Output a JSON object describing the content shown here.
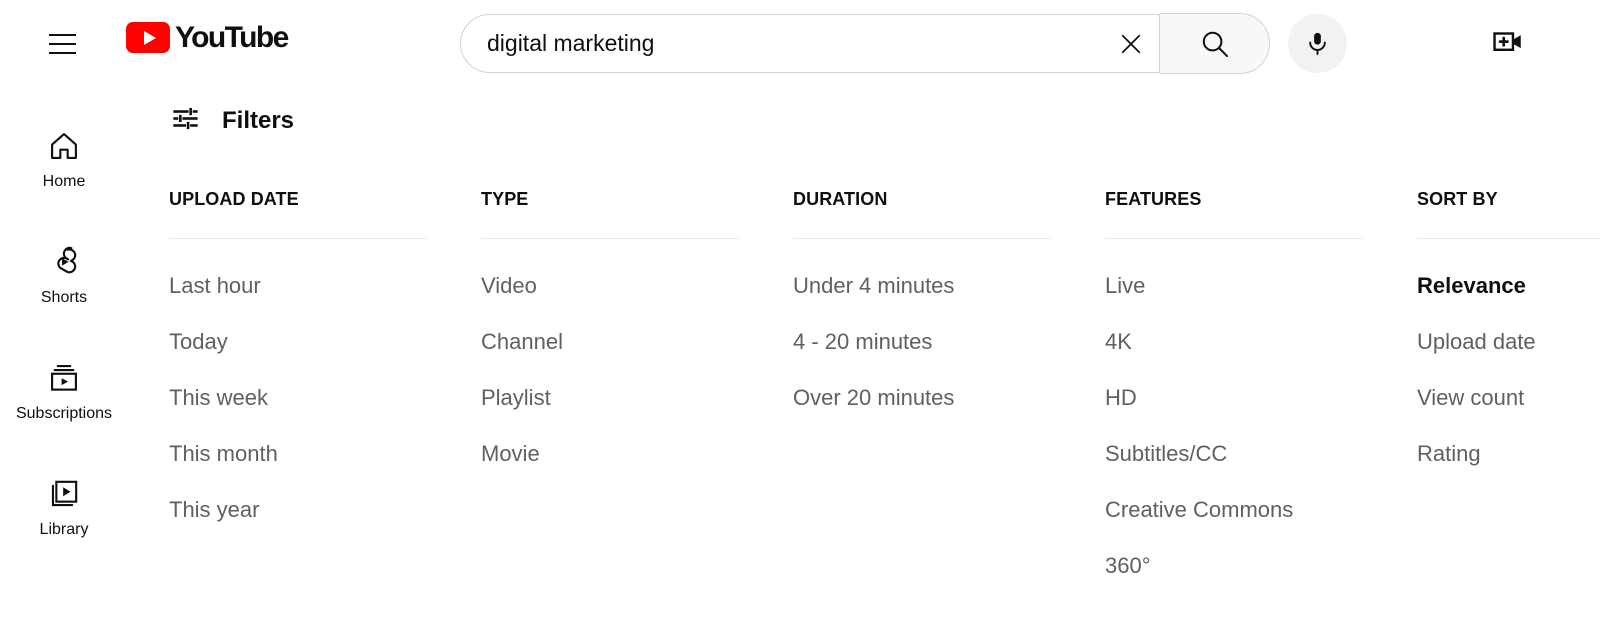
{
  "topbar": {
    "menu_icon": "hamburger-menu-icon",
    "logo_text": "YouTube",
    "logo_color": "#ff0000",
    "search": {
      "value": "digital marketing",
      "placeholder": "Search",
      "clear_icon": "close-x-icon",
      "search_icon": "magnifier-icon",
      "mic_icon": "microphone-icon"
    },
    "create_icon": "create-video-icon"
  },
  "sidebar": {
    "items": [
      {
        "label": "Home",
        "icon": "home-icon"
      },
      {
        "label": "Shorts",
        "icon": "shorts-icon"
      },
      {
        "label": "Subscriptions",
        "icon": "subscriptions-icon"
      },
      {
        "label": "Library",
        "icon": "library-icon"
      }
    ]
  },
  "filters": {
    "header_label": "Filters",
    "header_icon": "tune-sliders-icon",
    "columns": [
      {
        "title": "UPLOAD DATE",
        "items": [
          {
            "label": "Last hour",
            "selected": false
          },
          {
            "label": "Today",
            "selected": false
          },
          {
            "label": "This week",
            "selected": false
          },
          {
            "label": "This month",
            "selected": false
          },
          {
            "label": "This year",
            "selected": false
          }
        ]
      },
      {
        "title": "TYPE",
        "items": [
          {
            "label": "Video",
            "selected": false
          },
          {
            "label": "Channel",
            "selected": false
          },
          {
            "label": "Playlist",
            "selected": false
          },
          {
            "label": "Movie",
            "selected": false
          }
        ]
      },
      {
        "title": "DURATION",
        "items": [
          {
            "label": "Under 4 minutes",
            "selected": false
          },
          {
            "label": "4 - 20 minutes",
            "selected": false
          },
          {
            "label": "Over 20 minutes",
            "selected": false
          }
        ]
      },
      {
        "title": "FEATURES",
        "items": [
          {
            "label": "Live",
            "selected": false
          },
          {
            "label": "4K",
            "selected": false
          },
          {
            "label": "HD",
            "selected": false
          },
          {
            "label": "Subtitles/CC",
            "selected": false
          },
          {
            "label": "Creative Commons",
            "selected": false
          },
          {
            "label": "360°",
            "selected": false
          }
        ]
      },
      {
        "title": "SORT BY",
        "items": [
          {
            "label": "Relevance",
            "selected": true
          },
          {
            "label": "Upload date",
            "selected": false
          },
          {
            "label": "View count",
            "selected": false
          },
          {
            "label": "Rating",
            "selected": false
          }
        ]
      }
    ]
  },
  "colors": {
    "brand": "#ff0000",
    "text_primary": "#0f0f0f",
    "text_secondary": "#606060",
    "rule": "#e8e8e8"
  }
}
